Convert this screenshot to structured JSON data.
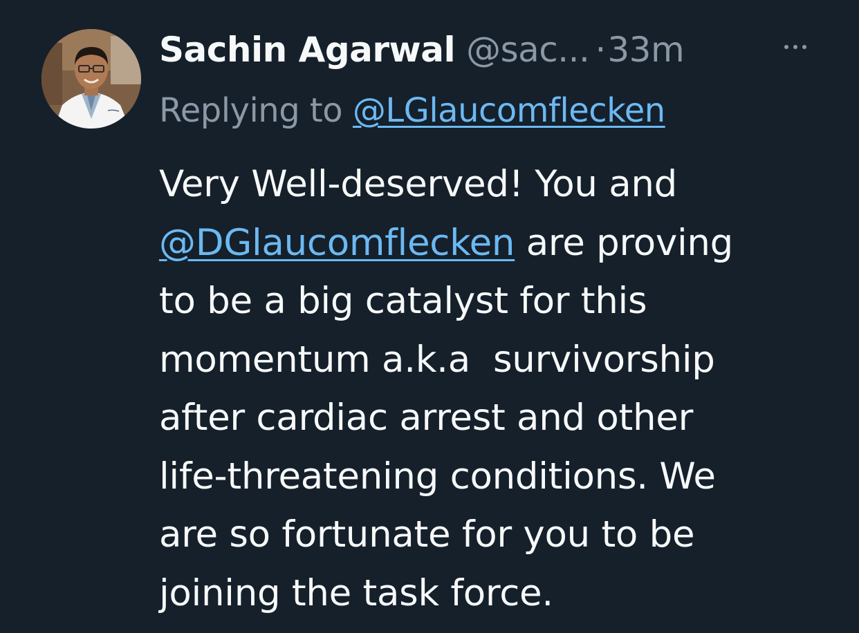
{
  "tweet": {
    "author_name": "Sachin Agarwal",
    "author_handle": "@sac...",
    "separator": "·",
    "timestamp": "33m",
    "more_icon": "more-horizontal-icon",
    "replying_prefix": "Replying to",
    "replying_to": "@LGlaucomflecken",
    "body": {
      "line1": "Very Well-deserved! You and",
      "mention": "@DGlaucomflecken",
      "line2_rest": " are proving",
      "line3": "to be a big catalyst for this",
      "line4": "momentum a.k.a  survivorship",
      "line5": "after cardiac arrest and other",
      "line6": "life-threatening conditions. We",
      "line7": "are so fortunate for you to be",
      "line8": "joining the task force."
    }
  },
  "colors": {
    "background": "#15202b",
    "primary_text": "#f7f9f9",
    "secondary_text": "#8b98a5",
    "link": "#6cb9f2"
  }
}
